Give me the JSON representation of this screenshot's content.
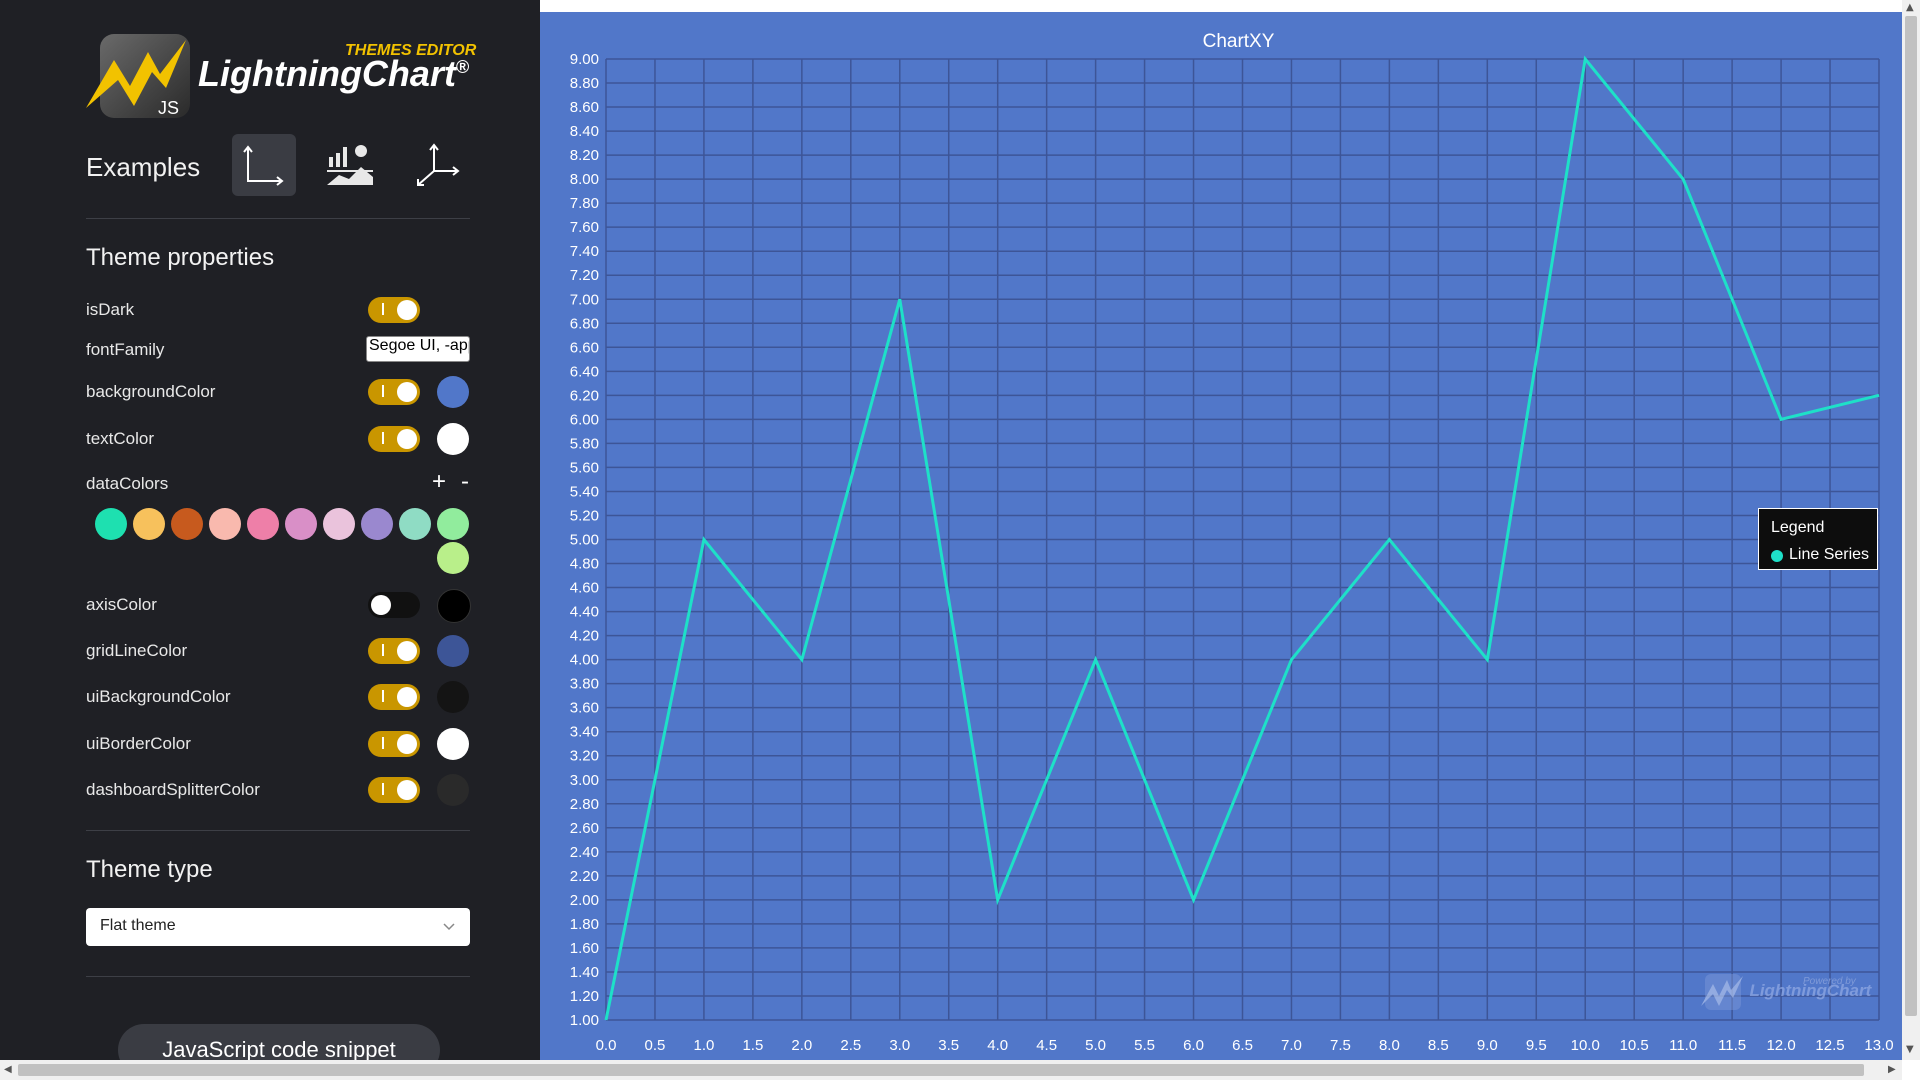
{
  "sidebar": {
    "logo": {
      "badge": "THEMES EDITOR",
      "name": "LightningChart",
      "reg": "®",
      "sub": "JS"
    },
    "examples_label": "Examples",
    "examples": [
      {
        "name": "xy-chart-icon",
        "active": true
      },
      {
        "name": "bar-area-chart-icon",
        "active": false
      },
      {
        "name": "3d-axes-icon",
        "active": false
      }
    ],
    "theme_properties_title": "Theme properties",
    "props": {
      "isDark": {
        "label": "isDark",
        "on": true
      },
      "fontFamily": {
        "label": "fontFamily",
        "value": "Segoe UI, -apple-system"
      },
      "backgroundColor": {
        "label": "backgroundColor",
        "on": true,
        "color": "#5177c9"
      },
      "textColor": {
        "label": "textColor",
        "on": true,
        "color": "#ffffff"
      },
      "dataColors": {
        "label": "dataColors",
        "add": "+",
        "remove": "-",
        "colors": [
          "#1ee0b0",
          "#f7c15c",
          "#c75a1e",
          "#f9b9ae",
          "#ee7fa8",
          "#d98fc7",
          "#eac3dc",
          "#9a88cf",
          "#8fdcc4",
          "#91ec9d",
          "#b9ef8a"
        ]
      },
      "axisColor": {
        "label": "axisColor",
        "on": false,
        "color": "#000000"
      },
      "gridLineColor": {
        "label": "gridLineColor",
        "on": true,
        "color": "#3d5597"
      },
      "uiBackgroundColor": {
        "label": "uiBackgroundColor",
        "on": true,
        "color": "#141414"
      },
      "uiBorderColor": {
        "label": "uiBorderColor",
        "on": true,
        "color": "#ffffff"
      },
      "dashboardSplitterColor": {
        "label": "dashboardSplitterColor",
        "on": true,
        "color": "#2a2a2a"
      }
    },
    "theme_type_title": "Theme type",
    "theme_type_value": "Flat theme",
    "code_snippet_button": "JavaScript code snippet"
  },
  "chart_data": {
    "type": "line",
    "title": "ChartXY",
    "x": [
      0,
      1,
      2,
      3,
      4,
      5,
      6,
      7,
      8,
      9,
      10,
      11,
      12,
      13
    ],
    "series": [
      {
        "name": "Line Series",
        "color": "#1ee0c8",
        "values": [
          1,
          5,
          4,
          7,
          2,
          4,
          2,
          4,
          5,
          4,
          9,
          8,
          6,
          6.2
        ]
      }
    ],
    "xlim": [
      0,
      13
    ],
    "ylim": [
      1,
      9
    ],
    "x_tick_step": 0.5,
    "y_tick_step": 0.2,
    "grid": true,
    "legend": {
      "title": "Legend",
      "placement": "right"
    },
    "background": "#5177c9",
    "grid_color": "#3d5597"
  },
  "watermark": {
    "text": "LightningChart",
    "small": "Powered by"
  }
}
